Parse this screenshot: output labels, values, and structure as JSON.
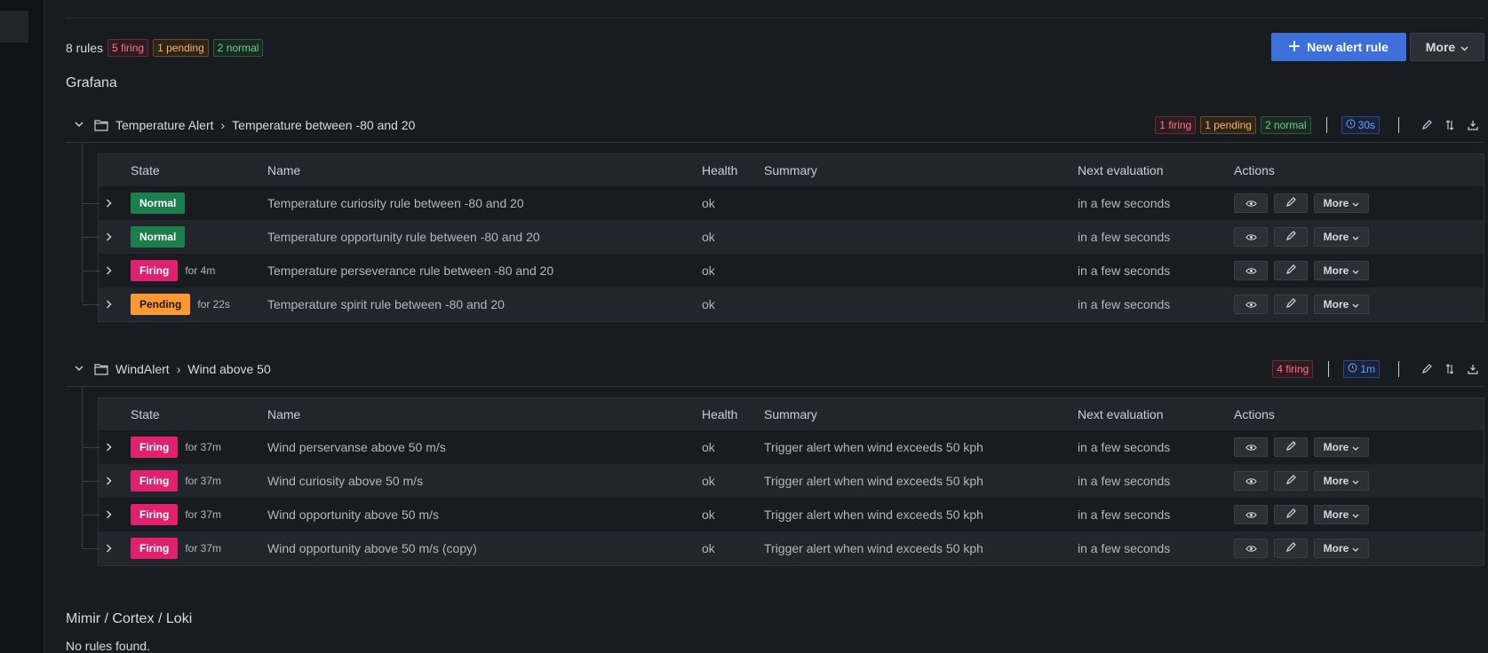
{
  "summary": {
    "rule_count": "8 rules",
    "firing": "5 firing",
    "pending": "1 pending",
    "normal": "2 normal"
  },
  "actions": {
    "new_rule": "New alert rule",
    "more": "More"
  },
  "sections": {
    "grafana": "Grafana",
    "mimir": "Mimir / Cortex / Loki",
    "mimir_empty": "No rules found."
  },
  "columns": {
    "state": "State",
    "name": "Name",
    "health": "Health",
    "summary": "Summary",
    "next": "Next evaluation",
    "actions": "Actions"
  },
  "groups": [
    {
      "folder": "Temperature Alert",
      "group": "Temperature between -80 and 20",
      "firing": "1 firing",
      "pending": "1 pending",
      "normal": "2 normal",
      "interval": "30s",
      "rules": [
        {
          "state": "Normal",
          "for": "",
          "name": "Temperature curiosity rule between -80 and 20",
          "health": "ok",
          "summary": "",
          "next": "in a few seconds",
          "more": "More"
        },
        {
          "state": "Normal",
          "for": "",
          "name": "Temperature opportunity rule between -80 and 20",
          "health": "ok",
          "summary": "",
          "next": "in a few seconds",
          "more": "More"
        },
        {
          "state": "Firing",
          "for": "for 4m",
          "name": "Temperature perseverance rule between -80 and 20",
          "health": "ok",
          "summary": "",
          "next": "in a few seconds",
          "more": "More"
        },
        {
          "state": "Pending",
          "for": "for 22s",
          "name": "Temperature spirit rule between -80 and 20",
          "health": "ok",
          "summary": "",
          "next": "in a few seconds",
          "more": "More"
        }
      ]
    },
    {
      "folder": "WindAlert",
      "group": "Wind above 50",
      "firing": "4 firing",
      "interval": "1m",
      "rules": [
        {
          "state": "Firing",
          "for": "for 37m",
          "name": "Wind perservanse above 50 m/s",
          "health": "ok",
          "summary": "Trigger alert when wind exceeds 50 kph",
          "next": "in a few seconds",
          "more": "More"
        },
        {
          "state": "Firing",
          "for": "for 37m",
          "name": "Wind curiosity above 50 m/s",
          "health": "ok",
          "summary": "Trigger alert when wind exceeds 50 kph",
          "next": "in a few seconds",
          "more": "More"
        },
        {
          "state": "Firing",
          "for": "for 37m",
          "name": "Wind opportunity above 50 m/s",
          "health": "ok",
          "summary": "Trigger alert when wind exceeds 50 kph",
          "next": "in a few seconds",
          "more": "More"
        },
        {
          "state": "Firing",
          "for": "for 37m",
          "name": "Wind opportunity above 50 m/s (copy)",
          "health": "ok",
          "summary": "Trigger alert when wind exceeds 50 kph",
          "next": "in a few seconds",
          "more": "More"
        }
      ]
    }
  ]
}
